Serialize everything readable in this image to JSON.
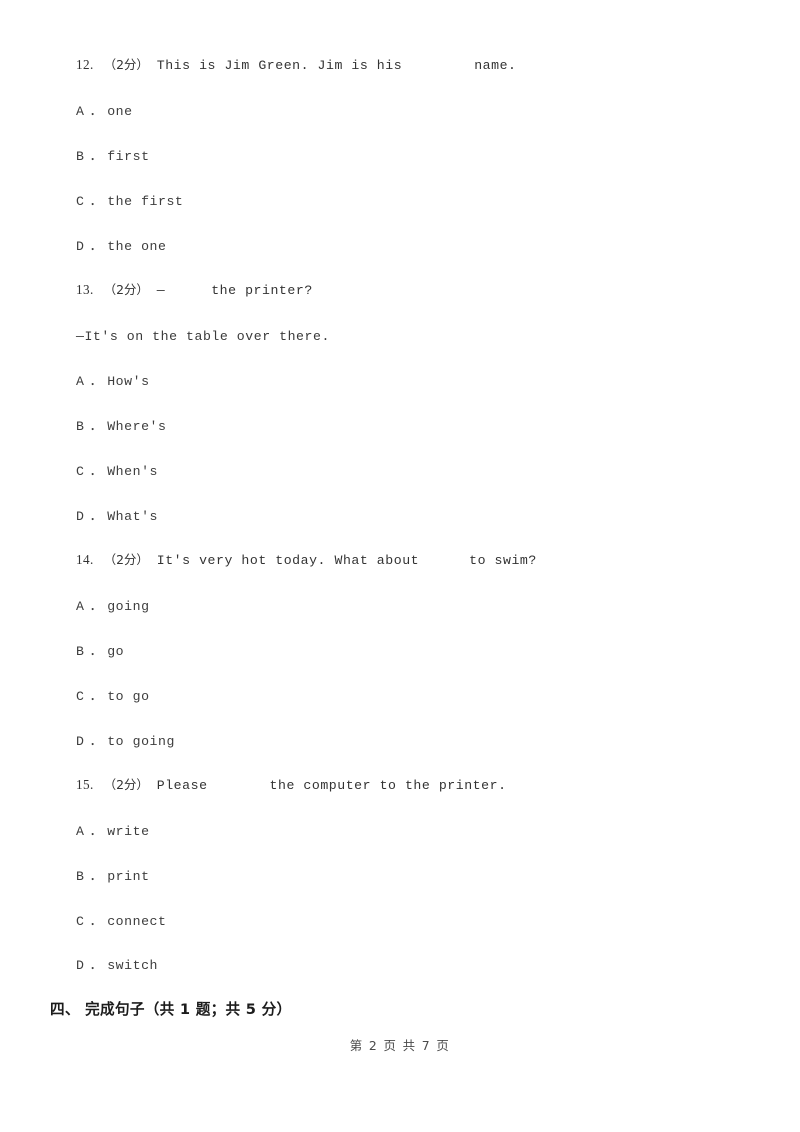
{
  "document": {
    "page_footer": "第 2 页 共 7 页",
    "section_heading": "四、 完成句子（共 1 题；共 5 分）"
  },
  "questions": [
    {
      "number": "12.",
      "score": "（2分）",
      "stem_before": "This is Jim Green. Jim is his",
      "stem_after": "name.",
      "continuation": "",
      "options": [
        {
          "letter": "A",
          "sep": "．",
          "text": "one"
        },
        {
          "letter": "B",
          "sep": "．",
          "text": "first"
        },
        {
          "letter": "C",
          "sep": "．",
          "text": "the first"
        },
        {
          "letter": "D",
          "sep": "．",
          "text": "the one"
        }
      ]
    },
    {
      "number": "13.",
      "score": "（2分）",
      "stem_before": "—",
      "stem_after": "the printer?",
      "continuation": "—It's on the table over there.",
      "options": [
        {
          "letter": "A",
          "sep": "．",
          "text": "How's"
        },
        {
          "letter": "B",
          "sep": "．",
          "text": "Where's"
        },
        {
          "letter": "C",
          "sep": "．",
          "text": "When's"
        },
        {
          "letter": "D",
          "sep": "．",
          "text": "What's"
        }
      ]
    },
    {
      "number": "14.",
      "score": "（2分）",
      "stem_before": "It's very hot today. What about",
      "stem_after": "to swim?",
      "continuation": "",
      "options": [
        {
          "letter": "A",
          "sep": "．",
          "text": "going"
        },
        {
          "letter": "B",
          "sep": "．",
          "text": "go"
        },
        {
          "letter": "C",
          "sep": "．",
          "text": "to go"
        },
        {
          "letter": "D",
          "sep": "．",
          "text": "to going"
        }
      ]
    },
    {
      "number": "15.",
      "score": "（2分）",
      "stem_before": "Please",
      "stem_after": "the computer to the printer.",
      "continuation": "",
      "options": [
        {
          "letter": "A",
          "sep": "．",
          "text": "write"
        },
        {
          "letter": "B",
          "sep": "．",
          "text": "print"
        },
        {
          "letter": "C",
          "sep": "．",
          "text": "connect"
        },
        {
          "letter": "D",
          "sep": "．",
          "text": "switch"
        }
      ]
    }
  ]
}
